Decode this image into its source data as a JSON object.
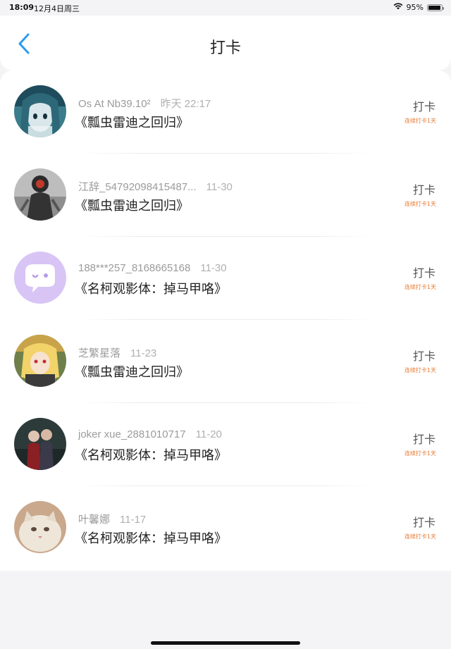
{
  "status_bar": {
    "time": "18:09",
    "date": "12月4日周三",
    "battery": "95%",
    "battery_level": 0.95
  },
  "nav": {
    "title": "打卡",
    "back_icon": "chevron-left-icon",
    "accent_color": "#2b9bf0"
  },
  "entries": [
    {
      "username": "Os At Nb39.10²",
      "time": "昨天 22:17",
      "content": "《瓢虫雷迪之回归》",
      "button": "打卡",
      "streak": "连续打卡1天",
      "avatar": "anime-girl-avatar"
    },
    {
      "username": "江辞_54792098415487...",
      "time": "11-30",
      "content": "《瓢虫雷迪之回归》",
      "button": "打卡",
      "streak": "连续打卡1天",
      "avatar": "masked-figure-avatar"
    },
    {
      "username": "188***257_8168665168",
      "time": "11-30",
      "content": "《名柯观影体：掉马甲咯》",
      "button": "打卡",
      "streak": "连续打卡1天",
      "avatar": "chat-bubble-avatar"
    },
    {
      "username": "芝繁星落",
      "time": "11-23",
      "content": "《瓢虫雷迪之回归》",
      "button": "打卡",
      "streak": "连续打卡1天",
      "avatar": "blonde-anime-avatar"
    },
    {
      "username": "joker xue_2881010717",
      "time": "11-20",
      "content": "《名柯观影体：掉马甲咯》",
      "button": "打卡",
      "streak": "连续打卡1天",
      "avatar": "couple-photo-avatar"
    },
    {
      "username": "叶馨娜",
      "time": "11-17",
      "content": "《名柯观影体：掉马甲咯》",
      "button": "打卡",
      "streak": "连续打卡1天",
      "avatar": "cat-avatar"
    }
  ],
  "colors": {
    "streak": "#e8772e",
    "background": "#f4f3f5",
    "card": "#ffffff"
  }
}
